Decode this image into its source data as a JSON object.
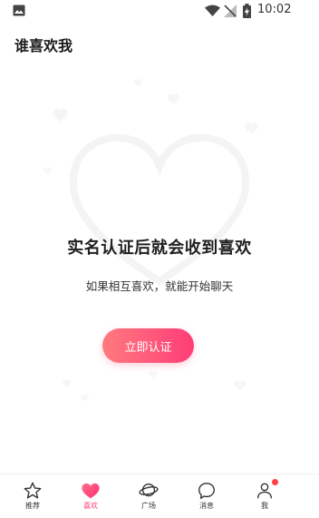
{
  "status_bar": {
    "time": "10:02"
  },
  "header": {
    "title": "谁喜欢我"
  },
  "empty_state": {
    "headline": "实名认证后就会收到喜欢",
    "subline": "如果相互喜欢，就能开始聊天",
    "button_label": "立即认证"
  },
  "tabbar": {
    "items": [
      {
        "label": "推荐",
        "icon": "star-icon",
        "active": false
      },
      {
        "label": "喜欢",
        "icon": "heart-icon",
        "active": true
      },
      {
        "label": "广场",
        "icon": "planet-icon",
        "active": false
      },
      {
        "label": "消息",
        "icon": "chat-bubble-icon",
        "active": false
      },
      {
        "label": "我",
        "icon": "person-icon",
        "active": false
      }
    ]
  },
  "colors": {
    "accent": "#ff3b73",
    "button_gradient_start": "#ff7a7e",
    "button_gradient_end": "#ff3d78",
    "notification_dot": "#ff4047"
  }
}
